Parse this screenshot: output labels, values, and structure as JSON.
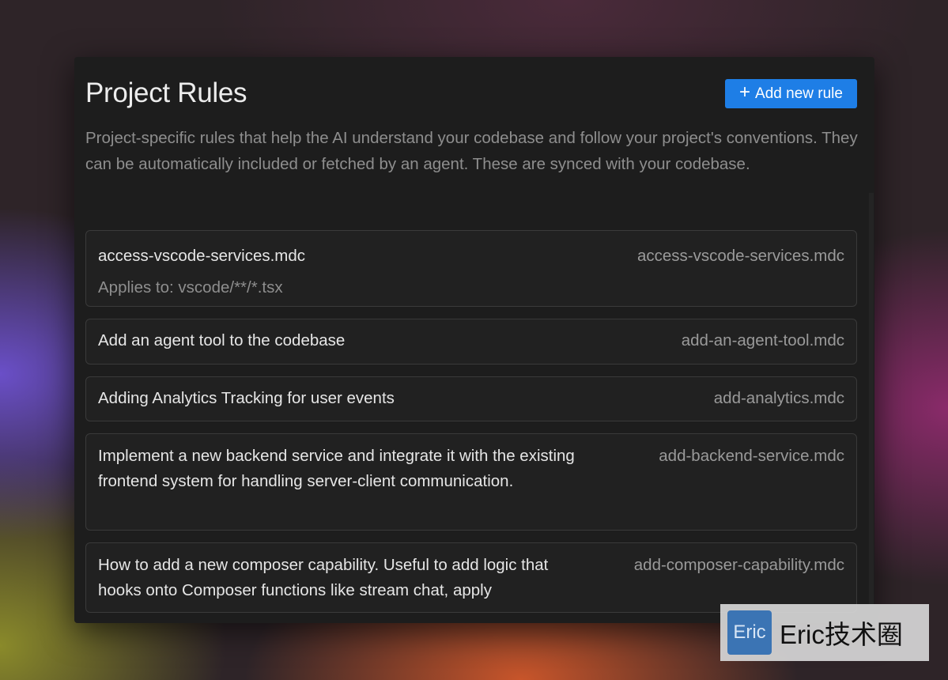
{
  "page": {
    "title": "Project Rules",
    "add_button_label": "Add new rule",
    "description": "Project-specific rules that help the AI understand your codebase and follow your project's conventions. They can be automatically included or fetched by an agent. These are synced with your codebase."
  },
  "rules": [
    {
      "title": "access-vscode-services.mdc",
      "file": "access-vscode-services.mdc",
      "applies_to": "Applies to: vscode/**/*.tsx"
    },
    {
      "title": "Add an agent tool to the codebase",
      "file": "add-an-agent-tool.mdc"
    },
    {
      "title": "Adding Analytics Tracking for user events",
      "file": "add-analytics.mdc"
    },
    {
      "title": "Implement a new backend service and integrate it with the existing frontend system for handling server-client communication.",
      "file": "add-backend-service.mdc"
    },
    {
      "title": "How to add a new composer capability. Useful to add logic that hooks onto Composer functions like stream chat, apply",
      "file": "add-composer-capability.mdc"
    }
  ],
  "watermark": {
    "logo_text": "Eric",
    "text": "Eric技术圈"
  },
  "colors": {
    "accent": "#1e7ee6",
    "panel_bg": "#1d1d1d",
    "card_border": "#3a3a3a"
  },
  "icons": {
    "add": "plus-icon"
  }
}
